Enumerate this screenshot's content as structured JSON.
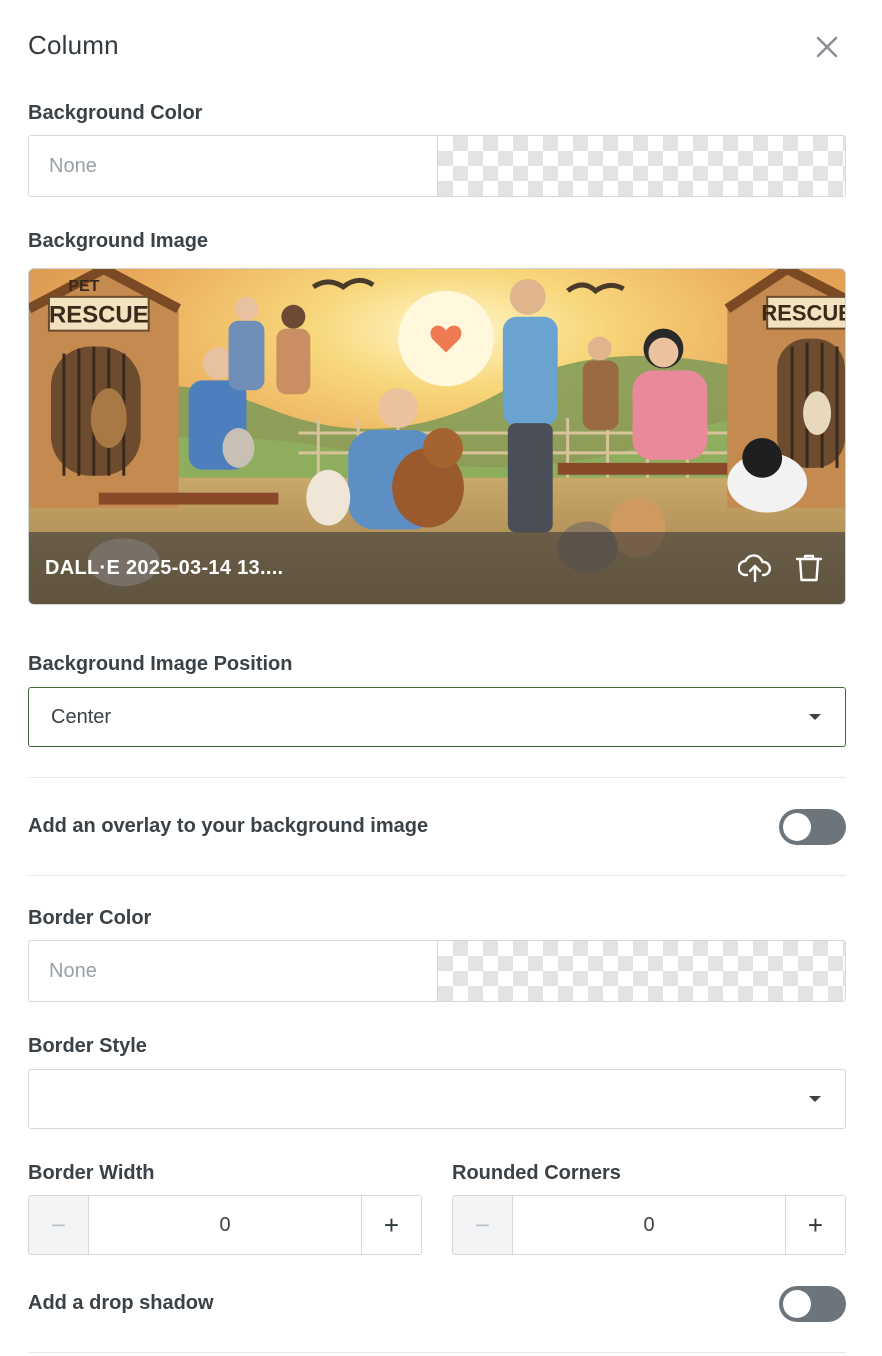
{
  "panel": {
    "title": "Column"
  },
  "background_color": {
    "label": "Background Color",
    "value": "None"
  },
  "background_image": {
    "label": "Background Image",
    "filename": "DALL·E 2025-03-14 13....",
    "sign_text_top": "PET",
    "sign_text_bottom": "RESCUE",
    "upload_icon": "cloud-upload-icon",
    "delete_icon": "trash-icon"
  },
  "background_image_position": {
    "label": "Background Image Position",
    "value": "Center"
  },
  "overlay": {
    "label": "Add an overlay to your background image",
    "enabled": false
  },
  "border_color": {
    "label": "Border Color",
    "value": "None"
  },
  "border_style": {
    "label": "Border Style",
    "value": ""
  },
  "border_width": {
    "label": "Border Width",
    "value": "0",
    "minus": "−",
    "plus": "+"
  },
  "rounded_corners": {
    "label": "Rounded Corners",
    "value": "0",
    "minus": "−",
    "plus": "+"
  },
  "drop_shadow": {
    "label": "Add a drop shadow",
    "enabled": false
  },
  "colors": {
    "focus_border": "#3e6b34",
    "toggle_off": "#6d757c"
  }
}
